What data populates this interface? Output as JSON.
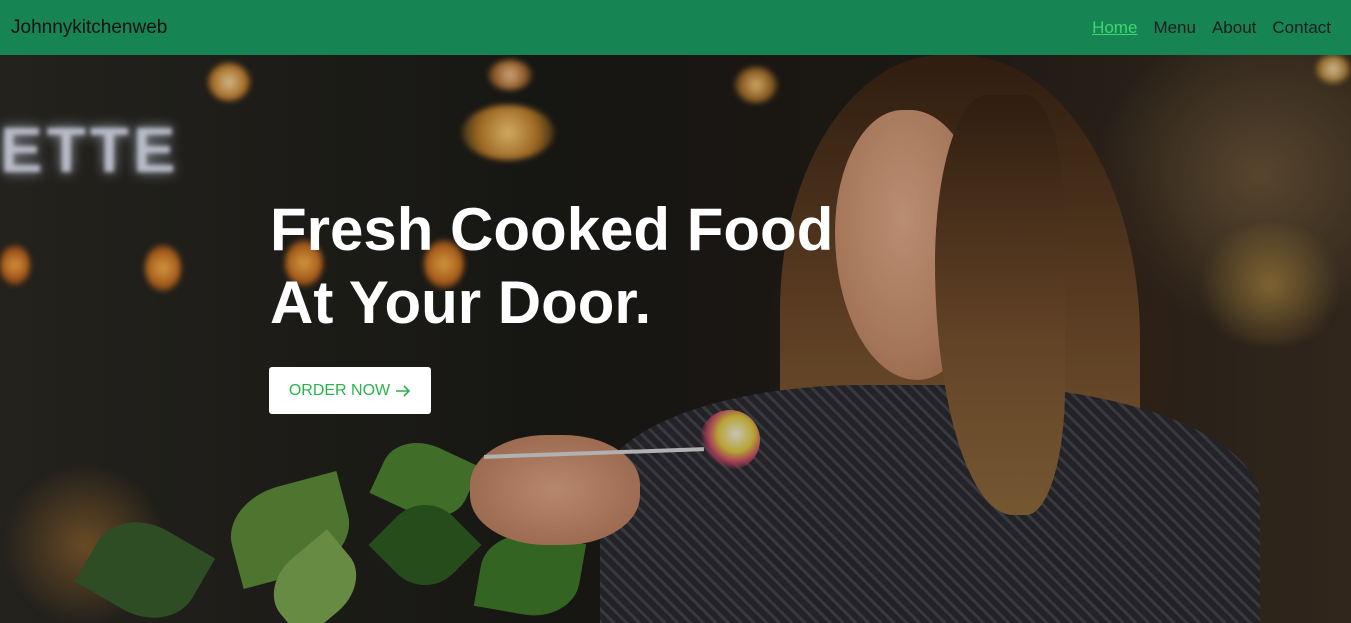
{
  "nav": {
    "brand": "Johnnykitchenweb",
    "links": [
      {
        "label": "Home",
        "active": true
      },
      {
        "label": "Menu",
        "active": false
      },
      {
        "label": "About",
        "active": false
      },
      {
        "label": "Contact",
        "active": false
      }
    ]
  },
  "hero": {
    "title_line1": "Fresh Cooked Food",
    "title_line2": "At Your Door.",
    "cta_label": "ORDER NOW",
    "cta_icon": "arrow-right-icon",
    "background_image": "woman-eating-pasta-cafe-photo"
  },
  "colors": {
    "navbar": "#168553",
    "active_link": "#3ed86f",
    "cta_text": "#2bb24c"
  }
}
